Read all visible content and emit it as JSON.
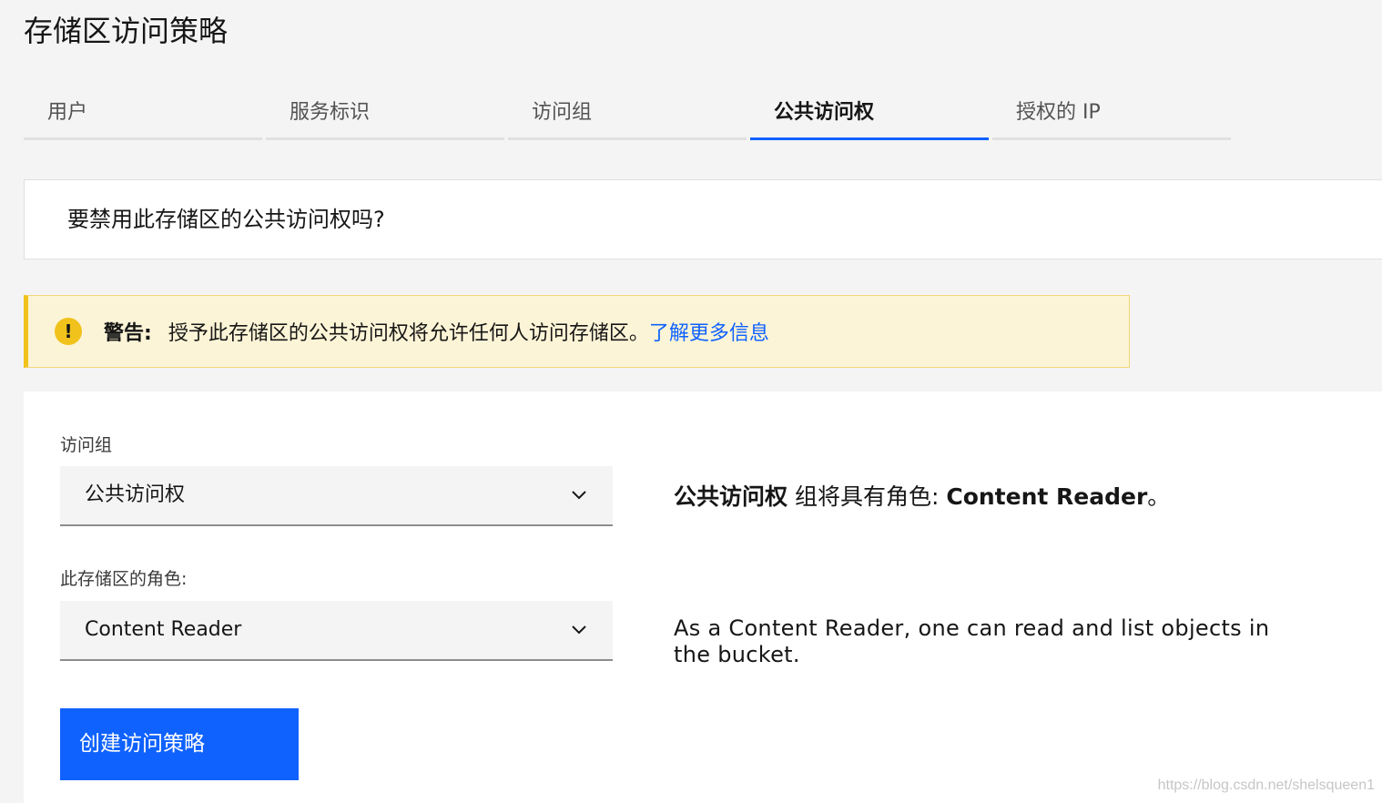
{
  "page": {
    "title": "存储区访问策略"
  },
  "tabs": [
    {
      "label": "用户",
      "active": false
    },
    {
      "label": "服务标识",
      "active": false
    },
    {
      "label": "访问组",
      "active": false
    },
    {
      "label": "公共访问权",
      "active": true
    },
    {
      "label": "授权的 IP",
      "active": false
    }
  ],
  "question": {
    "text": "要禁用此存储区的公共访问权吗?"
  },
  "warning": {
    "icon": "warning-icon",
    "icon_glyph": "!",
    "title": "警告:",
    "message": "授予此存储区的公共访问权将允许任何人访问存储区。",
    "link_text": "了解更多信息"
  },
  "form": {
    "group_label": "访问组",
    "group_value": "公共访问权",
    "role_label": "此存储区的角色:",
    "role_value": "Content Reader",
    "group_desc_bold": "公共访问权",
    "group_desc_text": " 组将具有角色: ",
    "group_desc_role": "Content Reader",
    "group_desc_end": "。",
    "role_desc": "As a Content Reader, one can read and list objects in the bucket.",
    "submit_label": "创建访问策略"
  },
  "watermark": "https://blog.csdn.net/shelsqueen1",
  "colors": {
    "accent": "#0f62fe",
    "warning": "#f1c21b",
    "warning_bg": "#fcf4d6"
  }
}
